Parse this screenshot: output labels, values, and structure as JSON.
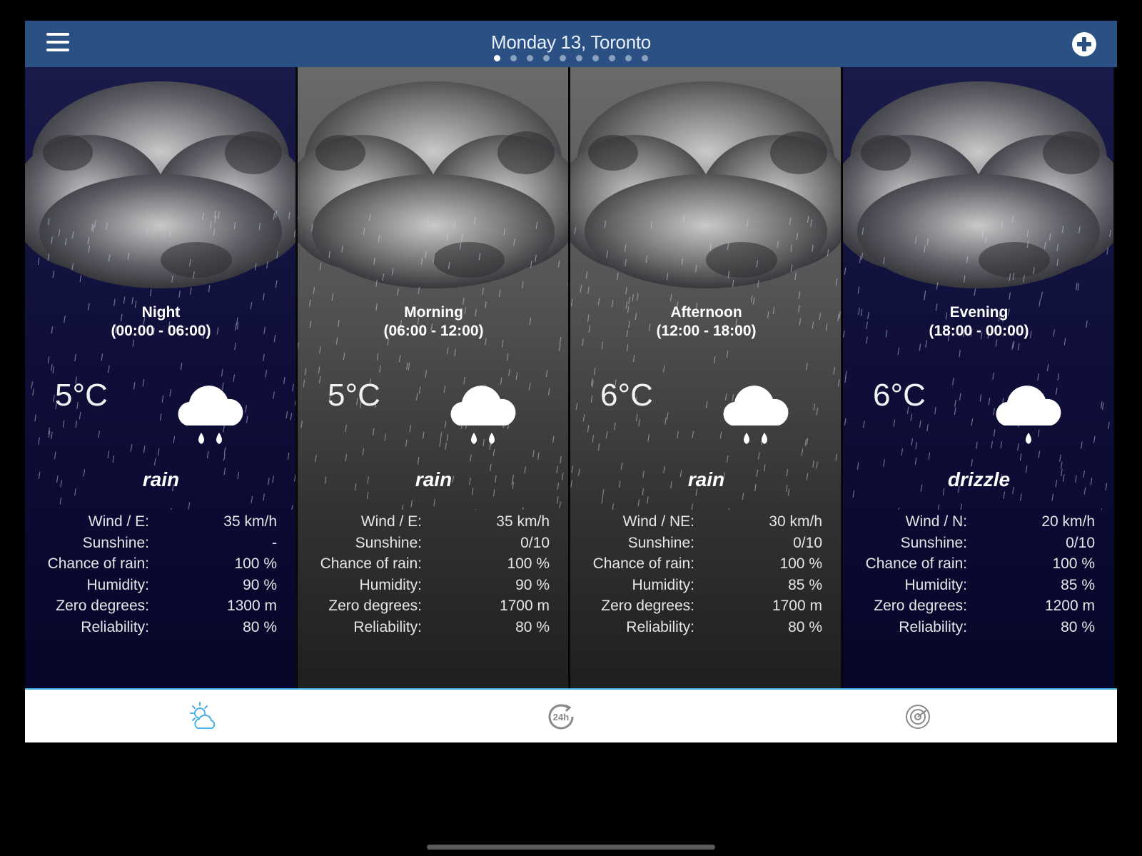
{
  "header": {
    "title": "Monday 13, Toronto",
    "page_dots": 10,
    "active_dot": 0,
    "menu_icon": "hamburger-menu-icon",
    "add_icon": "plus-circle-icon"
  },
  "colors": {
    "header_bg": "#2b5084",
    "night_bg": "#0f0f3a",
    "day_bg": "#444444",
    "tab_active": "#4ab0e8",
    "tab_inactive": "#8a8a8a"
  },
  "labels": {
    "wind_prefix": "Wind / ",
    "sunshine": "Sunshine:",
    "rain": "Chance of rain:",
    "humidity": "Humidity:",
    "zero": "Zero degrees:",
    "reliability": "Reliability:"
  },
  "periods": [
    {
      "name": "Night",
      "range": "(00:00 - 06:00)",
      "temp": "5°C",
      "condition": "rain",
      "icon": "rain-cloud-icon",
      "wind_dir": "E:",
      "wind": "35 km/h",
      "sunshine": "-",
      "rain": "100 %",
      "humidity": "90 %",
      "zero": "1300 m",
      "reliability": "80 %",
      "theme": "navy"
    },
    {
      "name": "Morning",
      "range": "(06:00 - 12:00)",
      "temp": "5°C",
      "condition": "rain",
      "icon": "rain-cloud-icon",
      "wind_dir": "E:",
      "wind": "35 km/h",
      "sunshine": "0/10",
      "rain": "100 %",
      "humidity": "90 %",
      "zero": "1700 m",
      "reliability": "80 %",
      "theme": "gray"
    },
    {
      "name": "Afternoon",
      "range": "(12:00 - 18:00)",
      "temp": "6°C",
      "condition": "rain",
      "icon": "rain-cloud-icon",
      "wind_dir": "NE:",
      "wind": "30 km/h",
      "sunshine": "0/10",
      "rain": "100 %",
      "humidity": "85 %",
      "zero": "1700 m",
      "reliability": "80 %",
      "theme": "gray"
    },
    {
      "name": "Evening",
      "range": "(18:00 - 00:00)",
      "temp": "6°C",
      "condition": "drizzle",
      "icon": "drizzle-cloud-icon",
      "wind_dir": "N:",
      "wind": "20 km/h",
      "sunshine": "0/10",
      "rain": "100 %",
      "humidity": "85 %",
      "zero": "1200 m",
      "reliability": "80 %",
      "theme": "navy"
    }
  ],
  "tabs": [
    {
      "icon": "partly-cloudy-icon",
      "active": true
    },
    {
      "icon": "24h-forecast-icon",
      "active": false
    },
    {
      "icon": "radar-icon",
      "active": false
    }
  ]
}
